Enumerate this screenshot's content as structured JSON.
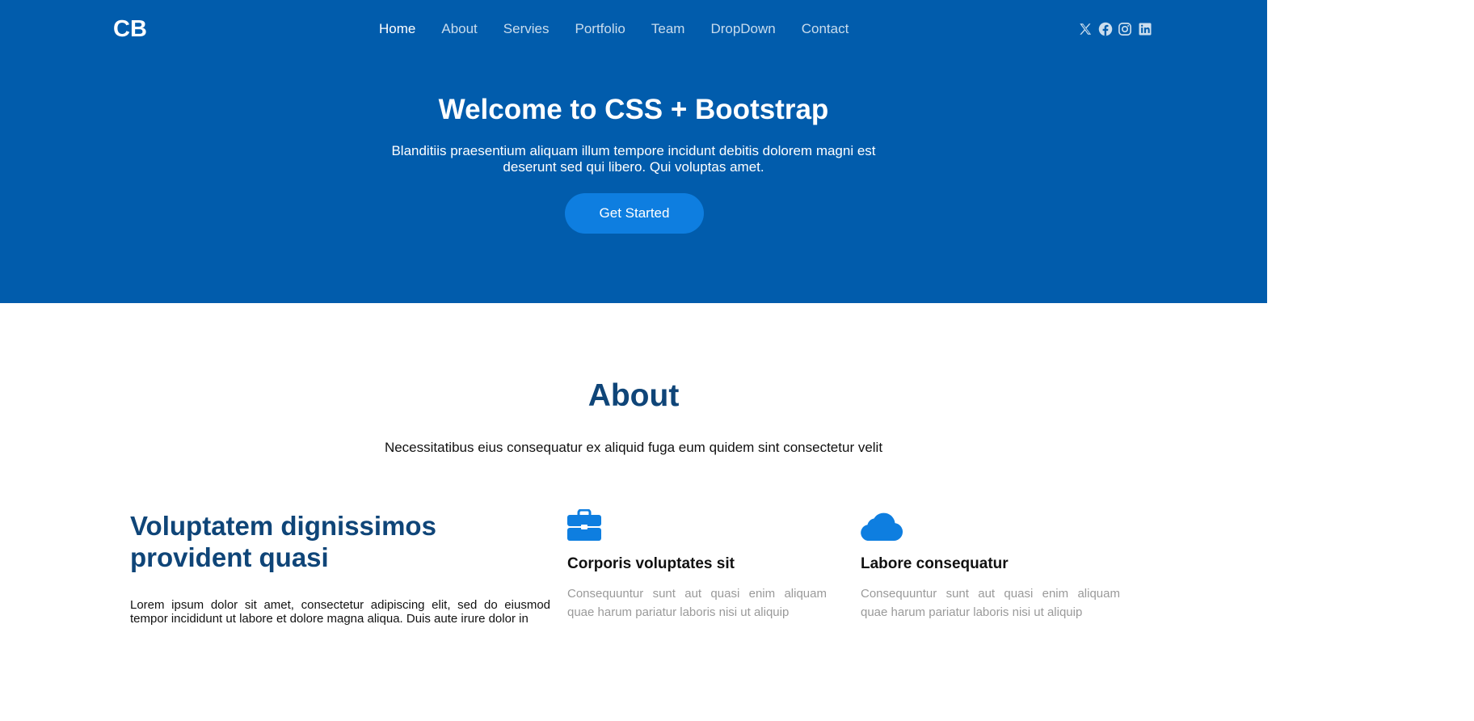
{
  "header": {
    "logo": "CB",
    "nav": [
      {
        "label": "Home",
        "active": true
      },
      {
        "label": "About",
        "active": false
      },
      {
        "label": "Servies",
        "active": false
      },
      {
        "label": "Portfolio",
        "active": false
      },
      {
        "label": "Team",
        "active": false
      },
      {
        "label": "DropDown",
        "active": false
      },
      {
        "label": "Contact",
        "active": false
      }
    ],
    "social_icons": [
      "x-icon",
      "facebook-icon",
      "instagram-icon",
      "linkedin-icon"
    ]
  },
  "hero": {
    "title": "Welcome to CSS + Bootstrap",
    "subtitle": "Blanditiis praesentium aliquam illum tempore incidunt debitis dolorem magni est deserunt sed qui libero. Qui voluptas amet.",
    "cta_label": "Get Started"
  },
  "about": {
    "title": "About",
    "subtitle": "Necessitatibus eius consequatur ex aliquid fuga eum quidem sint consectetur velit",
    "left": {
      "heading": "Voluptatem dignissimos provident quasi",
      "text": "Lorem ipsum dolor sit amet, consectetur adipiscing elit, sed do eiusmod tempor incididunt ut labore et dolore magna aliqua. Duis aute irure dolor in"
    },
    "features": [
      {
        "icon": "briefcase-icon",
        "title": "Corporis voluptates sit",
        "text": "Consequuntur sunt aut quasi enim aliquam quae harum pariatur laboris nisi ut aliquip"
      },
      {
        "icon": "cloud-icon",
        "title": "Labore consequatur",
        "text": "Consequuntur sunt aut quasi enim aliquam quae harum pariatur laboris nisi ut aliquip"
      }
    ]
  },
  "colors": {
    "hero_bg": "#015cac",
    "accent": "#0e7ee0",
    "heading": "#0f4578",
    "muted_text": "#9a9a9a"
  }
}
